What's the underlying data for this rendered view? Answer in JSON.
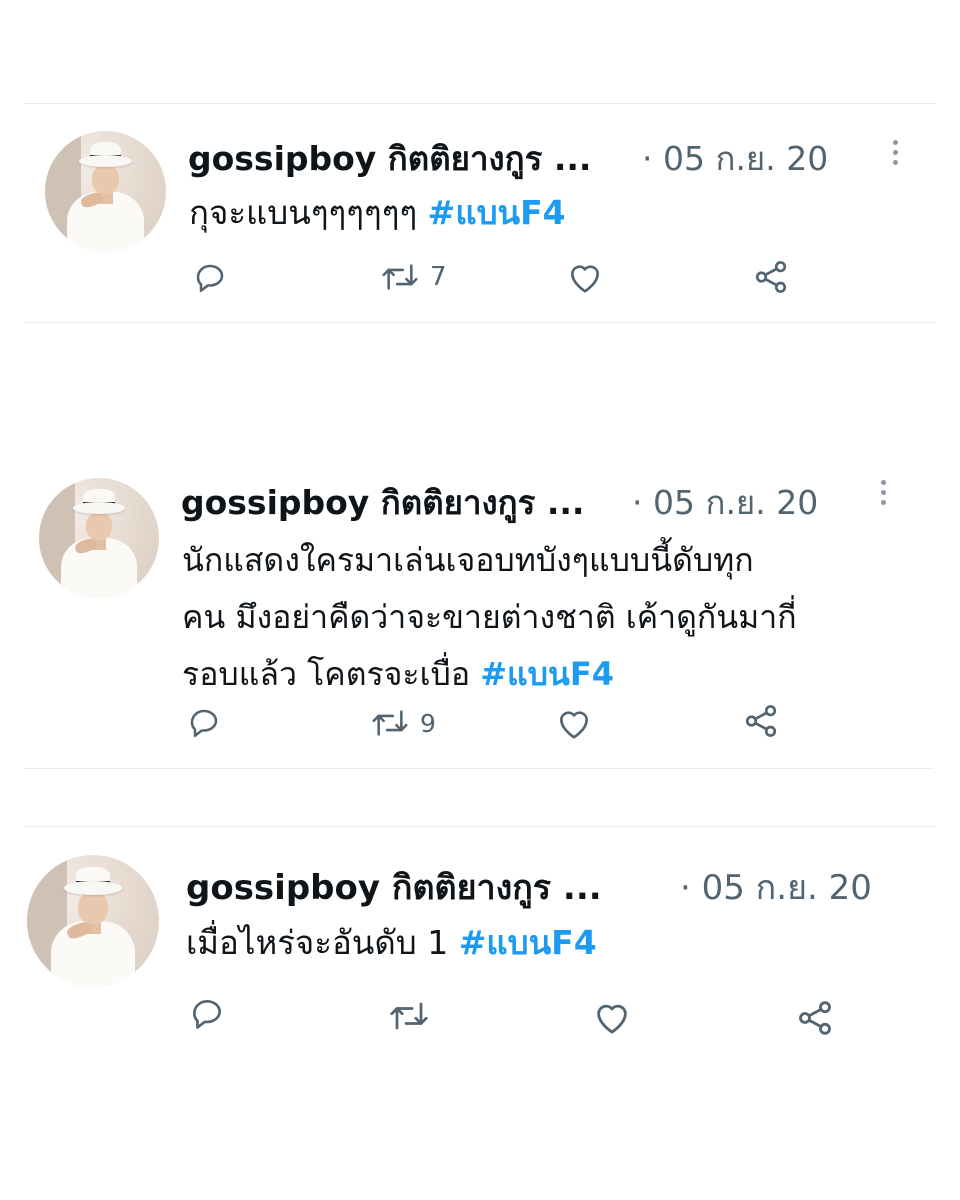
{
  "tweets": [
    {
      "name": "gossipboy กิตติยางกูร ...",
      "date": "· 05 ก.ย. 20",
      "text": "กุจะแบนๆๆๆๆๆๆ",
      "hashtag": "#แบนF4",
      "retweets": "7",
      "has_more_menu": true
    },
    {
      "name": "gossipboy กิตติยางกูร ...",
      "date": "· 05 ก.ย. 20",
      "lines": [
        "นักแสดงใครมาเล่นเจอบทบังๆแบบนี้ดับทุก",
        "คน มึงอย่าคืดว่าจะขายต่างชาติ เค้าดูกันมากี่",
        "รอบแล้ว โคตรจะเบื่อ"
      ],
      "hashtag": "#แบนF4",
      "retweets": "9",
      "has_more_menu": true
    },
    {
      "name": "gossipboy กิตติยางกูร ...",
      "date": "· 05 ก.ย. 20",
      "text": "เมื่อไหร่จะอันดับ 1",
      "hashtag": "#แบนF4",
      "retweets": "",
      "has_more_menu": false
    }
  ],
  "icons": {
    "reply": "reply-icon",
    "retweet": "retweet-icon",
    "like": "heart-icon",
    "share": "share-icon",
    "more": "more-vertical-icon"
  },
  "colors": {
    "hashtag": "#1d9bf0",
    "secondary_text": "#536471",
    "divider": "#e6ecf0"
  }
}
